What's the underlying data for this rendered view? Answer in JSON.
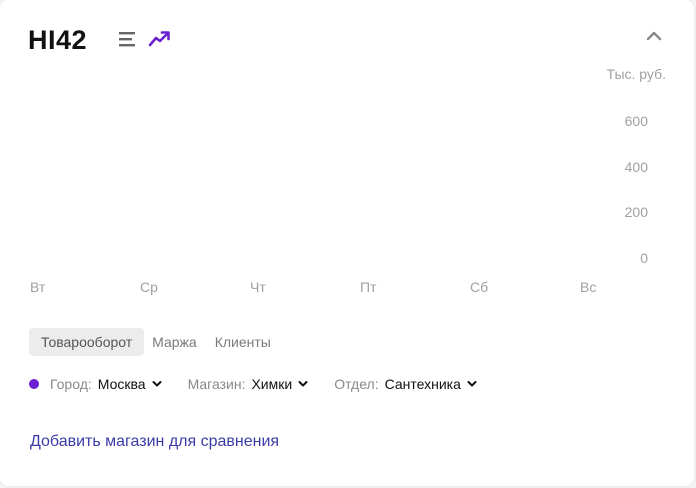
{
  "header": {
    "logo_text": "HI42",
    "collapse_icon": "chevron-up-icon",
    "view_icons": [
      "list-icon",
      "trend-icon"
    ]
  },
  "chart_data": {
    "type": "line",
    "ylabel": "Тыс. руб.",
    "y_ticks": [
      "600",
      "400",
      "200",
      "0"
    ],
    "ylim": [
      0,
      600
    ],
    "categories": [
      "Вт",
      "Ср",
      "Чт",
      "Пт",
      "Сб",
      "Вс"
    ],
    "series": []
  },
  "metrics": {
    "tabs": [
      {
        "label": "Товарооборот",
        "active": true
      },
      {
        "label": "Маржа",
        "active": false
      },
      {
        "label": "Клиенты",
        "active": false
      }
    ]
  },
  "filters": {
    "city_label": "Город:",
    "city_value": "Москва",
    "store_label": "Магазин:",
    "store_value": "Химки",
    "dept_label": "Отдел:",
    "dept_value": "Сантехника"
  },
  "actions": {
    "add_store": "Добавить магазин для сравнения"
  },
  "colors": {
    "accent": "#6a1fd1",
    "link": "#3b3ba8",
    "muted": "#a0a0a0"
  }
}
